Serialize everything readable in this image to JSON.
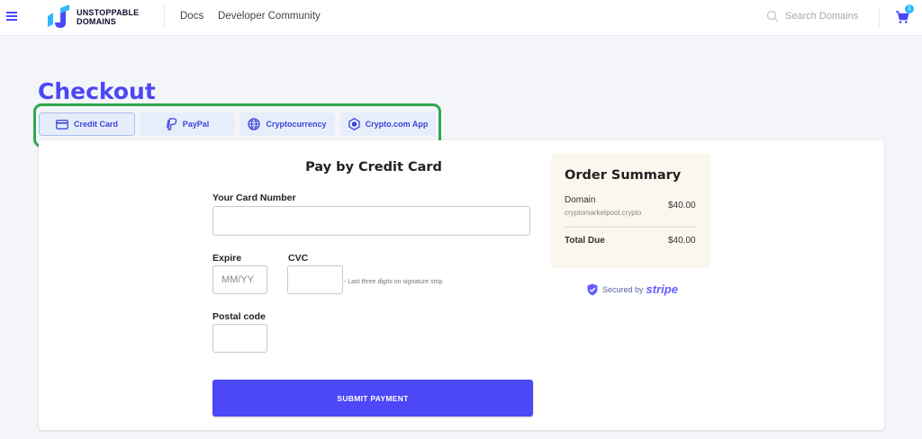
{
  "header": {
    "logo_line1": "UNSTOPPABLE",
    "logo_line2": "DOMAINS",
    "nav": [
      {
        "label": "Docs"
      },
      {
        "label": "Developer Community"
      }
    ],
    "search_placeholder": "Search Domains",
    "cart_count": "1",
    "colors": {
      "accent": "#4c47f7",
      "badge": "#2fb8ff"
    }
  },
  "page": {
    "title": "Checkout"
  },
  "payment_methods": [
    {
      "label": "Credit Card",
      "icon": "credit-card-icon",
      "active": true
    },
    {
      "label": "PayPal",
      "icon": "paypal-icon",
      "active": false
    },
    {
      "label": "Cryptocurrency",
      "icon": "globe-icon",
      "active": false
    },
    {
      "label": "Crypto.com App",
      "icon": "crypto-com-icon",
      "active": false
    }
  ],
  "form": {
    "title": "Pay by Credit Card",
    "card_number_label": "Your Card Number",
    "card_number_value": "",
    "expire_label": "Expire",
    "expire_placeholder": "MM/YY",
    "cvc_label": "CVC",
    "cvc_value": "",
    "cvc_hint": "- Last three digits on signature strip",
    "postal_label": "Postal code",
    "postal_value": "",
    "submit_label": "SUBMIT PAYMENT"
  },
  "order_summary": {
    "title": "Order Summary",
    "item_label": "Domain",
    "item_name": "cryptomarketpool.crypto",
    "item_price": "$40.00",
    "total_label": "Total Due",
    "total_price": "$40.00",
    "secured_label": "Secured by",
    "secured_brand": "stripe"
  },
  "highlight": {
    "color": "#2fa84f"
  }
}
